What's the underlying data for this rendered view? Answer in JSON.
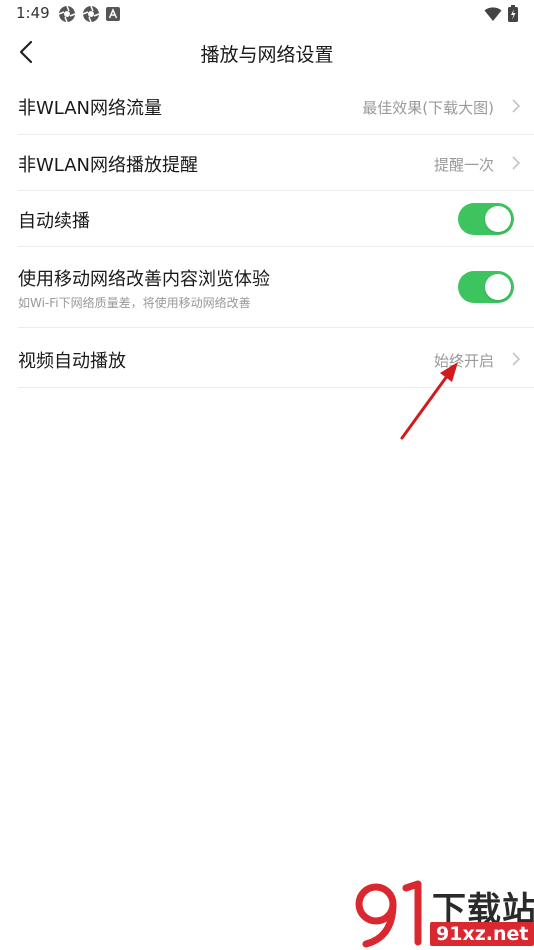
{
  "status_bar": {
    "time": "1:49"
  },
  "header": {
    "title": "播放与网络设置"
  },
  "settings": {
    "items": [
      {
        "label": "非WLAN网络流量",
        "value": "最佳效果(下载大图)"
      },
      {
        "label": "非WLAN网络播放提醒",
        "value": "提醒一次"
      },
      {
        "label": "自动续播",
        "toggle_on": true
      },
      {
        "label": "使用移动网络改善内容浏览体验",
        "subtitle": "如Wi-Fi下网络质量差，将使用移动网络改善",
        "toggle_on": true
      },
      {
        "label": "视频自动播放",
        "value": "始终开启"
      }
    ]
  },
  "watermark": {
    "brand_text": "下载站",
    "domain_text": "91xz.net"
  },
  "colors": {
    "toggle_on": "#3dc45f",
    "annotation_arrow": "#d01c1c",
    "watermark_red": "#d9282f"
  }
}
